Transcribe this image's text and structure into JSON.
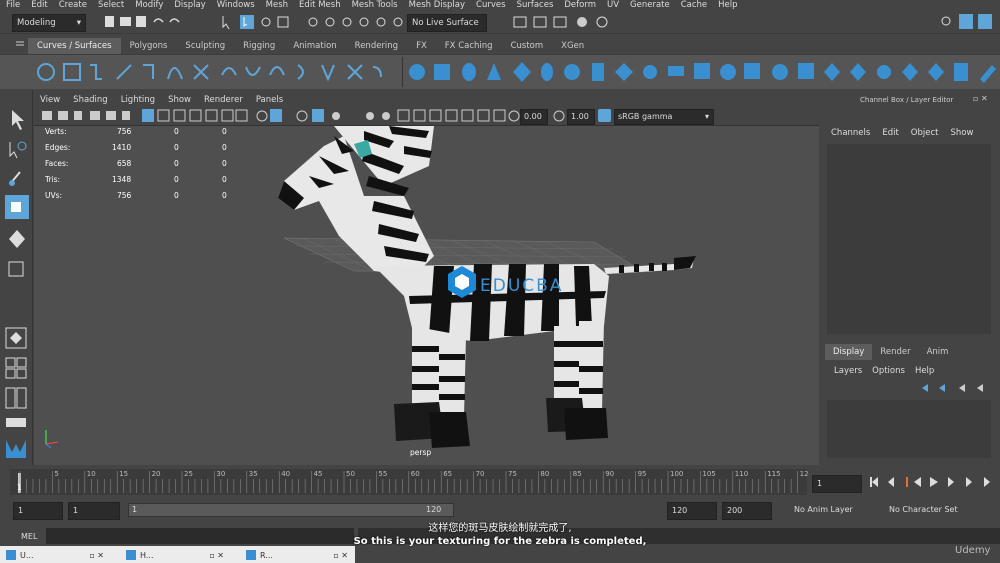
{
  "menu": [
    "File",
    "Edit",
    "Create",
    "Select",
    "Modify",
    "Display",
    "Windows",
    "Mesh",
    "Edit Mesh",
    "Mesh Tools",
    "Mesh Display",
    "Curves",
    "Surfaces",
    "Deform",
    "UV",
    "Generate",
    "Cache",
    "Help"
  ],
  "status": {
    "mode": "Modeling",
    "live_surface": "No Live Surface"
  },
  "shelf_tabs": [
    "Curves / Surfaces",
    "Polygons",
    "Sculpting",
    "Rigging",
    "Animation",
    "Rendering",
    "FX",
    "FX Caching",
    "Custom",
    "XGen"
  ],
  "viewport": {
    "menu": [
      "View",
      "Shading",
      "Lighting",
      "Show",
      "Renderer",
      "Panels"
    ],
    "exposure": "0.00",
    "gamma": "1.00",
    "color_space": "sRGB gamma",
    "camera_label": "persp"
  },
  "hud": [
    {
      "label": "Verts:",
      "v1": "756",
      "v2": "0",
      "v3": "0"
    },
    {
      "label": "Edges:",
      "v1": "1410",
      "v2": "0",
      "v3": "0"
    },
    {
      "label": "Faces:",
      "v1": "658",
      "v2": "0",
      "v3": "0"
    },
    {
      "label": "Tris:",
      "v1": "1348",
      "v2": "0",
      "v3": "0"
    },
    {
      "label": "UVs:",
      "v1": "756",
      "v2": "0",
      "v3": "0"
    }
  ],
  "watermark": "EDUCBA",
  "channel_box": {
    "title": "Channel Box / Layer Editor",
    "menu": [
      "Channels",
      "Edit",
      "Object",
      "Show"
    ],
    "layer_tabs": [
      "Display",
      "Render",
      "Anim"
    ],
    "layer_menu": [
      "Layers",
      "Options",
      "Help"
    ]
  },
  "timeline": {
    "ticks": [
      "5",
      "10",
      "15",
      "20",
      "25",
      "30",
      "35",
      "40",
      "45",
      "50",
      "55",
      "60",
      "65",
      "70",
      "75",
      "80",
      "85",
      "90",
      "95",
      "100",
      "105",
      "110",
      "115",
      "12"
    ],
    "first": "1",
    "current_frame": "1"
  },
  "range": {
    "start": "1",
    "start2": "1",
    "slider_start": "1",
    "slider_end": "120",
    "end": "120",
    "end2": "200",
    "anim_layer": "No Anim Layer",
    "char_set": "No Character Set"
  },
  "mel_label": "MEL",
  "subtitles": {
    "zh": "这样您的斑马皮肤绘制就完成了,",
    "en": "So this is your texturing for the zebra is completed,"
  },
  "udemy": "Udemy",
  "taskbar": [
    {
      "label": "U..."
    },
    {
      "label": "H..."
    },
    {
      "label": "R..."
    }
  ],
  "colors": {
    "accent": "#5ea5d8",
    "icon_blue": "#3a8fd0",
    "bg": "#444444"
  }
}
